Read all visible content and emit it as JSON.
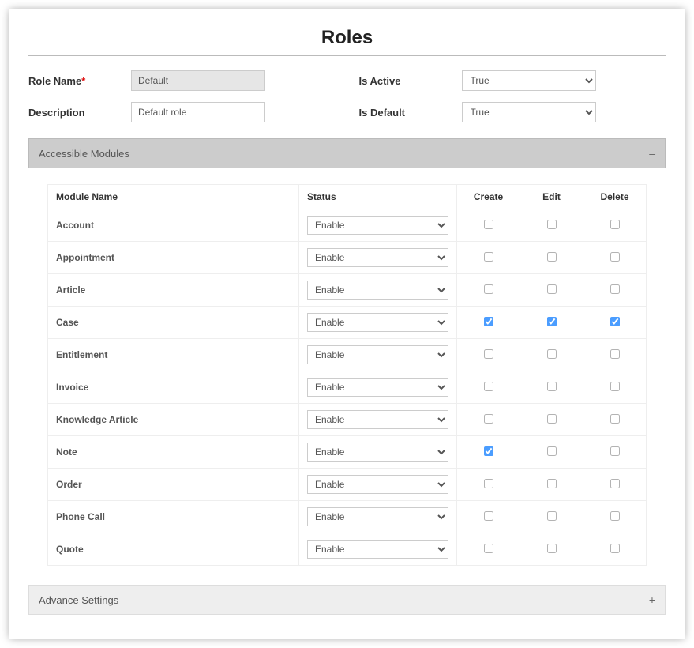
{
  "page": {
    "title": "Roles"
  },
  "form": {
    "roleNameLabel": "Role Name",
    "roleNameValue": "Default",
    "descriptionLabel": "Description",
    "descriptionValue": "Default role",
    "isActiveLabel": "Is Active",
    "isActiveValue": "True",
    "isDefaultLabel": "Is Default",
    "isDefaultValue": "True",
    "requiredMark": "*"
  },
  "sections": {
    "accessible": {
      "title": "Accessible Modules",
      "toggle": "–"
    },
    "advance": {
      "title": "Advance Settings",
      "toggle": "+"
    }
  },
  "table": {
    "headers": {
      "moduleName": "Module Name",
      "status": "Status",
      "create": "Create",
      "edit": "Edit",
      "delete": "Delete"
    },
    "statusOption": "Enable",
    "rows": [
      {
        "name": "Account",
        "create": false,
        "edit": false,
        "delete": false
      },
      {
        "name": "Appointment",
        "create": false,
        "edit": false,
        "delete": false
      },
      {
        "name": "Article",
        "create": false,
        "edit": false,
        "delete": false
      },
      {
        "name": "Case",
        "create": true,
        "edit": true,
        "delete": true
      },
      {
        "name": "Entitlement",
        "create": false,
        "edit": false,
        "delete": false
      },
      {
        "name": "Invoice",
        "create": false,
        "edit": false,
        "delete": false
      },
      {
        "name": "Knowledge Article",
        "create": false,
        "edit": false,
        "delete": false
      },
      {
        "name": "Note",
        "create": true,
        "edit": false,
        "delete": false
      },
      {
        "name": "Order",
        "create": false,
        "edit": false,
        "delete": false
      },
      {
        "name": "Phone Call",
        "create": false,
        "edit": false,
        "delete": false
      },
      {
        "name": "Quote",
        "create": false,
        "edit": false,
        "delete": false
      }
    ]
  }
}
